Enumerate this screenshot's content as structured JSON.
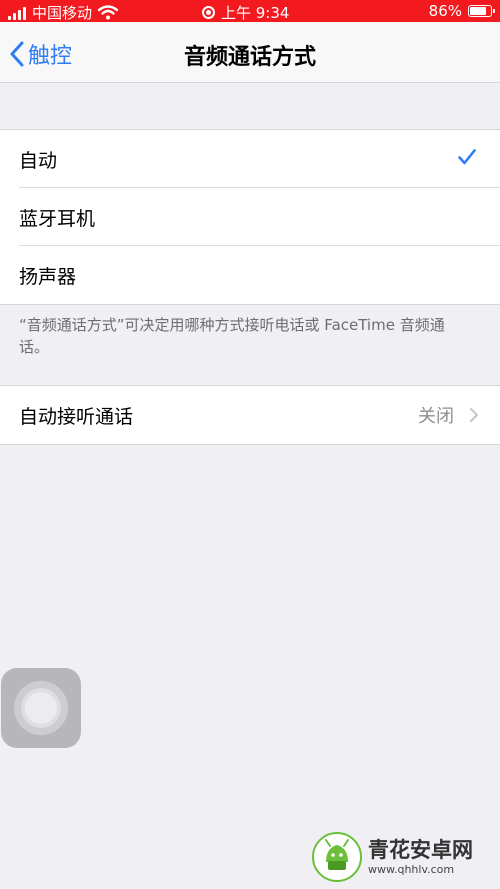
{
  "status_bar": {
    "carrier": "中国移动",
    "time": "上午 9:34",
    "battery": "86%",
    "battery_level": 0.86,
    "background": "#f2191f"
  },
  "nav": {
    "back_label": "触控",
    "title": "音频通话方式",
    "accent": "#2f7cf6"
  },
  "options": [
    {
      "label": "自动",
      "selected": true
    },
    {
      "label": "蓝牙耳机",
      "selected": false
    },
    {
      "label": "扬声器",
      "selected": false
    }
  ],
  "footnote": "“音频通话方式”可决定用哪种方式接听电话或 FaceTime 音频通话。",
  "auto_answer": {
    "label": "自动接听通话",
    "value": "关闭"
  },
  "icons": [
    "wifi-icon",
    "checkmark-icon",
    "chevron-right-icon",
    "back-chevron-icon",
    "assistive-touch-icon"
  ],
  "watermark": {
    "name": "青花安卓网",
    "url": "www.qhhlv.com"
  }
}
